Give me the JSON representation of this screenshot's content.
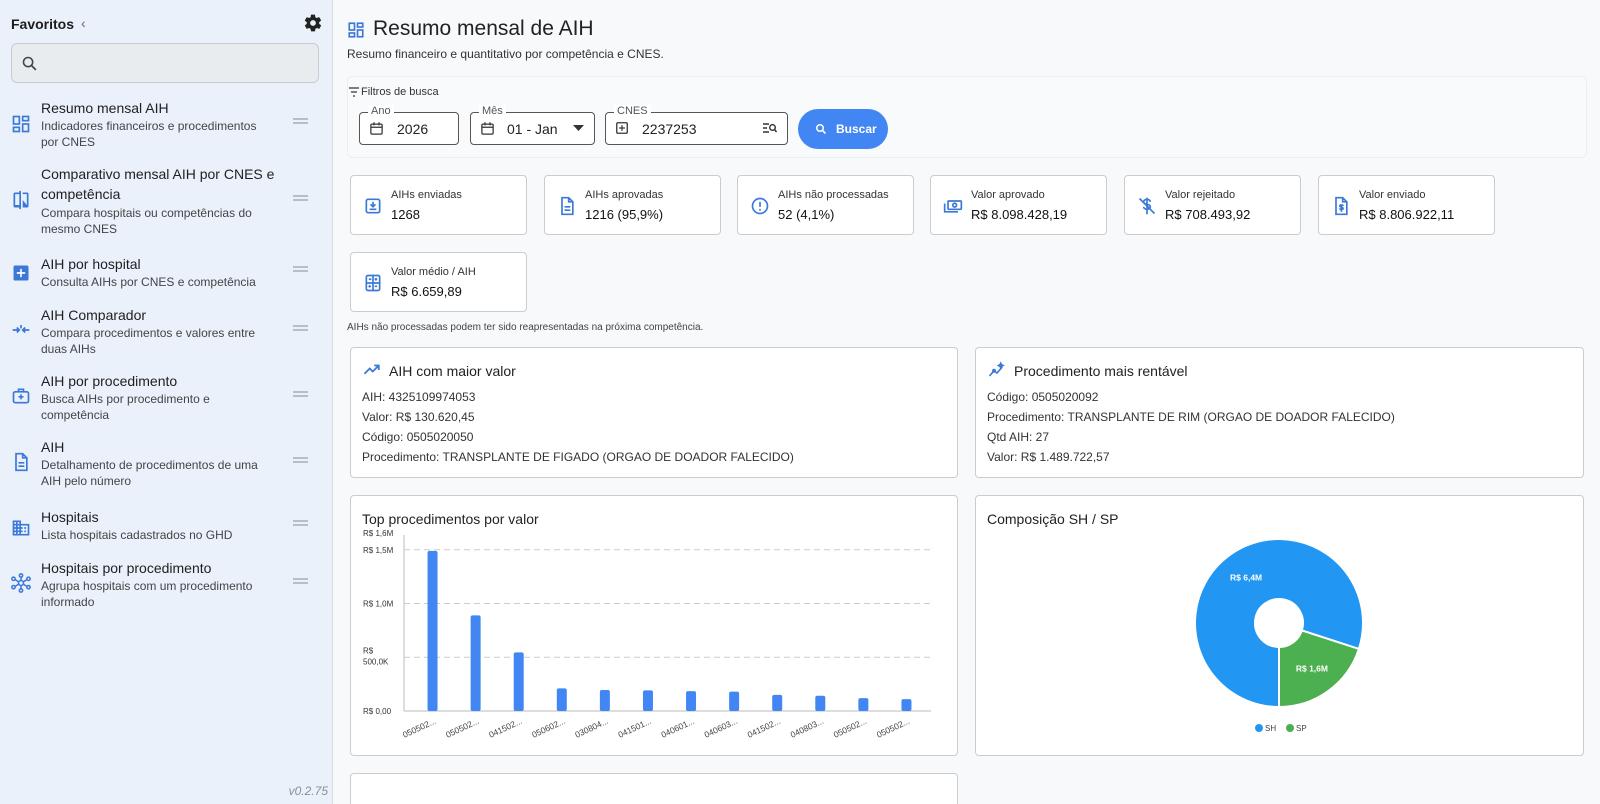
{
  "sidebar": {
    "title": "Favoritos",
    "search_placeholder": "",
    "version": "v0.2.75",
    "items": [
      {
        "title": "Resumo mensal AIH",
        "desc": "Indicadores financeiros e procedimentos por CNES",
        "icon": "dashboard-icon"
      },
      {
        "title": "Comparativo mensal AIH por CNES e competência",
        "desc": "Compara hospitais ou competências do mesmo CNES",
        "icon": "compare-icon"
      },
      {
        "title": "AIH por hospital",
        "desc": "Consulta AIHs por CNES e competência",
        "icon": "hospital-plus-icon"
      },
      {
        "title": "AIH Comparador",
        "desc": "Compara procedimentos e valores entre duas AIHs",
        "icon": "arrows-compare-icon"
      },
      {
        "title": "AIH por procedimento",
        "desc": "Busca AIHs por procedimento e competência",
        "icon": "medical-bag-icon"
      },
      {
        "title": "AIH",
        "desc": "Detalhamento de procedimentos de uma AIH pelo número",
        "icon": "document-icon"
      },
      {
        "title": "Hospitais",
        "desc": "Lista hospitais cadastrados no GHD",
        "icon": "building-icon"
      },
      {
        "title": "Hospitais por procedimento",
        "desc": "Agrupa hospitais com um procedimento informado",
        "icon": "network-icon"
      }
    ]
  },
  "header": {
    "title": "Resumo mensal de AIH",
    "subtitle": "Resumo financeiro e quantitativo por competência e CNES."
  },
  "filters": {
    "label": "Filtros de busca",
    "ano_label": "Ano",
    "ano_value": "2026",
    "mes_label": "Mês",
    "mes_value": "01 - Jan",
    "cnes_label": "CNES",
    "cnes_value": "2237253",
    "search_button": "Buscar"
  },
  "kpis": [
    {
      "label": "AIHs enviadas",
      "value": "1268",
      "icon": "upload-box-icon"
    },
    {
      "label": "AIHs aprovadas",
      "value": "1216 (95,9%)",
      "icon": "document-icon"
    },
    {
      "label": "AIHs não processadas",
      "value": "52 (4,1%)",
      "icon": "alert-circle-icon"
    },
    {
      "label": "Valor aprovado",
      "value": "R$ 8.098.428,19",
      "icon": "cash-icon"
    },
    {
      "label": "Valor rejeitado",
      "value": "R$ 708.493,92",
      "icon": "dollar-off-icon"
    },
    {
      "label": "Valor enviado",
      "value": "R$ 8.806.922,11",
      "icon": "dollar-file-icon"
    },
    {
      "label": "Valor médio / AIH",
      "value": "R$ 6.659,89",
      "icon": "calculator-icon"
    }
  ],
  "kpi_note": "AIHs não processadas podem ter sido reapresentadas na próxima competência.",
  "top_aih": {
    "title": "AIH com maior valor",
    "lines": [
      "AIH: 4325109974053",
      "Valor: R$ 130.620,45",
      "Código: 0505020050",
      "Procedimento: TRANSPLANTE DE FIGADO (ORGAO DE DOADOR FALECIDO)"
    ]
  },
  "top_proc": {
    "title": "Procedimento mais rentável",
    "lines": [
      "Código: 0505020092",
      "Procedimento: TRANSPLANTE DE RIM (ORGAO DE DOADOR FALECIDO)",
      "Qtd AIH: 27",
      "Valor: R$ 1.489.722,57"
    ]
  },
  "bar_card": {
    "title": "Top procedimentos por valor"
  },
  "pie_card": {
    "title": "Composição SH / SP"
  },
  "colors": {
    "accent": "#4286f4",
    "sh": "#2196f3",
    "sp": "#4caf50"
  },
  "chart_data": [
    {
      "type": "bar",
      "title": "Top procedimentos por valor",
      "categories": [
        "050502...",
        "050502...",
        "041502...",
        "050602...",
        "030804...",
        "041501...",
        "040601...",
        "040603...",
        "041502...",
        "040803...",
        "050502...",
        "050502..."
      ],
      "values": [
        1489722,
        890000,
        545000,
        210000,
        195000,
        192000,
        185000,
        180000,
        150000,
        142000,
        120000,
        110000
      ],
      "ylim": [
        0,
        1600000
      ],
      "yticks": [
        {
          "v": 0,
          "label": "R$ 0,00"
        },
        {
          "v": 500000,
          "label": "R$ 500,0K"
        },
        {
          "v": 1000000,
          "label": "R$ 1,0M"
        },
        {
          "v": 1500000,
          "label": "R$ 1,5M"
        },
        {
          "v": 1600000,
          "label": "R$ 1,6M"
        }
      ],
      "grid": true
    },
    {
      "type": "pie",
      "title": "Composição SH / SP",
      "labels": [
        "SH",
        "SP"
      ],
      "values": [
        6.4,
        1.6
      ],
      "data_labels": [
        "R$ 6,4M",
        "R$ 1,6M"
      ],
      "legend": "bottom"
    }
  ]
}
